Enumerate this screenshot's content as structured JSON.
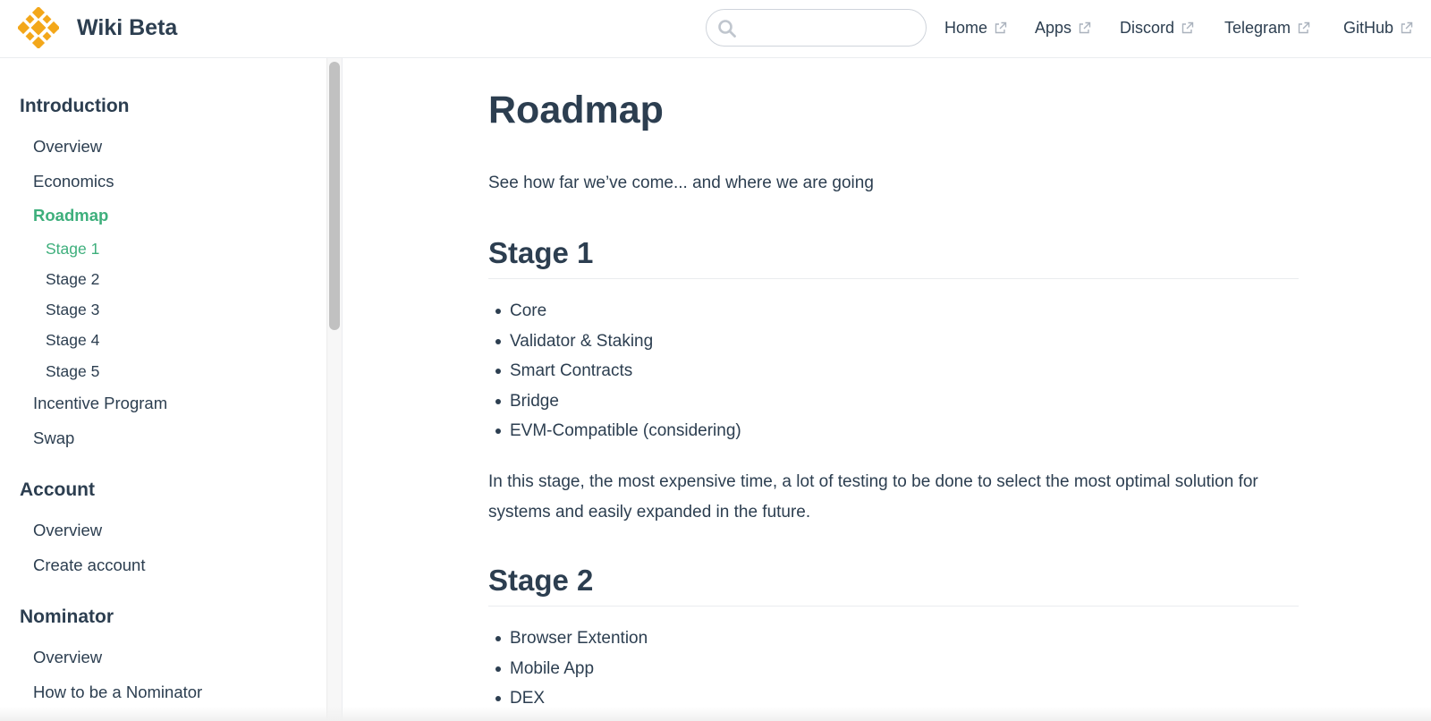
{
  "navbar": {
    "site_name": "Wiki Beta",
    "search": {
      "placeholder": "",
      "value": ""
    },
    "links": [
      {
        "label": "Home"
      },
      {
        "label": "Apps"
      },
      {
        "label": "Discord"
      },
      {
        "label": "Telegram"
      },
      {
        "label": "GitHub"
      }
    ],
    "logo_color": "#f3a71a"
  },
  "sidebar": {
    "groups": [
      {
        "title": "Introduction",
        "items": [
          {
            "label": "Overview"
          },
          {
            "label": "Economics"
          },
          {
            "label": "Roadmap",
            "active": true,
            "children": [
              {
                "label": "Stage 1",
                "active": true
              },
              {
                "label": "Stage 2"
              },
              {
                "label": "Stage 3"
              },
              {
                "label": "Stage 4"
              },
              {
                "label": "Stage 5"
              }
            ]
          },
          {
            "label": "Incentive Program"
          },
          {
            "label": "Swap"
          }
        ]
      },
      {
        "title": "Account",
        "items": [
          {
            "label": "Overview"
          },
          {
            "label": "Create account"
          }
        ]
      },
      {
        "title": "Nominator",
        "items": [
          {
            "label": "Overview"
          },
          {
            "label": "How to be a Nominator"
          }
        ]
      }
    ],
    "active_color": "#3eaf7c"
  },
  "page": {
    "title": "Roadmap",
    "intro": "See how far we’ve come... and where we are going",
    "stages": [
      {
        "heading": "Stage 1",
        "items": [
          "Core",
          "Validator & Staking",
          "Smart Contracts",
          "Bridge",
          "EVM-Compatible (considering)"
        ],
        "description": "In this stage, the most expensive time, a lot of testing to be done to select the most optimal solution for systems and easily expanded in the future."
      },
      {
        "heading": "Stage 2",
        "items": [
          "Browser Extention",
          "Mobile App",
          "DEX"
        ]
      }
    ]
  },
  "colors": {
    "text": "#2c3e50",
    "accent": "#3eaf7c",
    "border": "#eaecef"
  }
}
